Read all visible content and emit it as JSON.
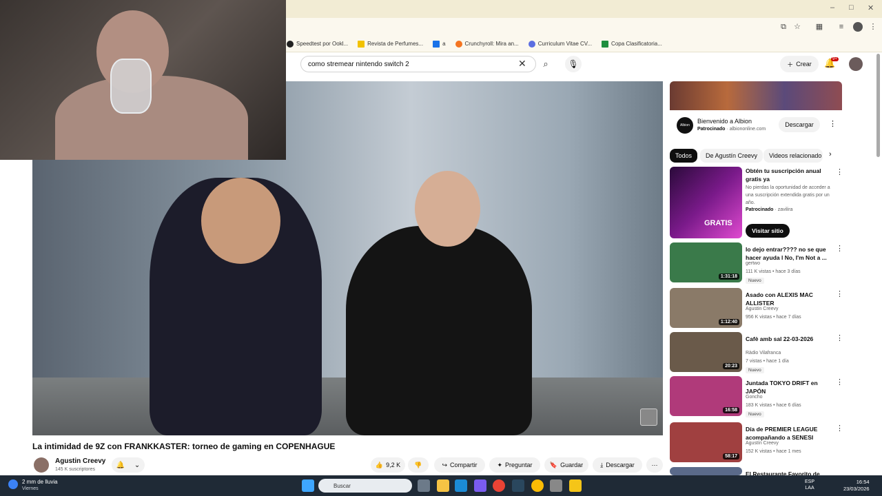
{
  "browser": {
    "window_controls": [
      "–",
      "□",
      "✕"
    ],
    "bookmarks": [
      {
        "label": "Speedtest por Ookl...",
        "color": "#222222"
      },
      {
        "label": "Revista de Perfumes...",
        "color": "#f2c200"
      },
      {
        "label": "a",
        "color": "#1a73e8"
      },
      {
        "label": "Crunchyroll: Mira an...",
        "color": "#f47521"
      },
      {
        "label": "Curriculum Vitae CV...",
        "color": "#5b6ee1"
      },
      {
        "label": "Copa Clasificatoria...",
        "color": "#1e8e3e"
      }
    ]
  },
  "youtube": {
    "search": {
      "query": "como stremear nintendo switch 2"
    },
    "create_label": "Crear",
    "notif_badge": "9+"
  },
  "video": {
    "title": "La intimidad de 9Z con FRANKKASTER: torneo de gaming en COPENHAGUE",
    "channel": "Agustin Creevy",
    "subscribers": "145 K suscriptores",
    "likes": "9,2 K",
    "actions": {
      "share": "Compartir",
      "ask": "Preguntar",
      "save": "Guardar",
      "download": "Descargar",
      "more": "⋯"
    }
  },
  "sidebar": {
    "ad": {
      "title": "Bienvenido a Albion",
      "sponsor_label": "Patrocinado",
      "domain": "albiononline.com",
      "cta": "Descargar",
      "logo": "Albion"
    },
    "chips": [
      "Todos",
      "De Agustín Creevy",
      "Videos relacionado"
    ],
    "promo": {
      "title": "Obtén tu suscripción anual gratis ya",
      "description": "No pierdas la oportunidad de acceder a una suscripción extendida gratis por un año.",
      "sponsor": "Patrocinado",
      "advertiser": "zavilira",
      "cta": "Visitar sitio",
      "thumb_text": "GRATIS"
    },
    "videos": [
      {
        "title": "lo dejo entrar???? no se que hacer ayuda l No, I'm Not a ...",
        "channel": "gertwo",
        "meta": "111 K vistas • hace 3 días",
        "badge": "Nuevo",
        "duration": "1:31:18",
        "color": "#3a7a4a"
      },
      {
        "title": "Asado con ALEXIS MAC ALLISTER",
        "channel": "Agustin Creevy",
        "meta": "956 K vistas • hace 7 días",
        "badge": "",
        "duration": "1:12:40",
        "color": "#8a7a68"
      },
      {
        "title": "Cafè amb sal 22-03-2026",
        "channel": "Ràdio Vilafranca",
        "meta": "7 vistas • hace 1 día",
        "badge": "Nuevo",
        "duration": "20:23",
        "color": "#6a5a4a"
      },
      {
        "title": "Juntada TOKYO DRIFT en JAPÓN",
        "channel": "Goncho",
        "meta": "183 K vistas • hace 6 días",
        "badge": "Nuevo",
        "duration": "16:58",
        "color": "#b03a7a"
      },
      {
        "title": "Día de PREMIER LEAGUE acompañando a SENESI",
        "channel": "Agustín Creevy",
        "meta": "152 K vistas • hace 1 mes",
        "badge": "",
        "duration": "58:17",
        "color": "#a04040"
      },
      {
        "title": "El Restaurante Favorito de",
        "channel": "",
        "meta": "",
        "badge": "",
        "duration": "",
        "color": "#5a6a8a"
      }
    ]
  },
  "taskbar": {
    "weather": "2 mm de lluvia",
    "weather_sub": "Viernes",
    "search_placeholder": "Buscar",
    "lang": "ESP",
    "lang_sub": "LAA",
    "time": "16:54",
    "date": "23/03/2026"
  }
}
